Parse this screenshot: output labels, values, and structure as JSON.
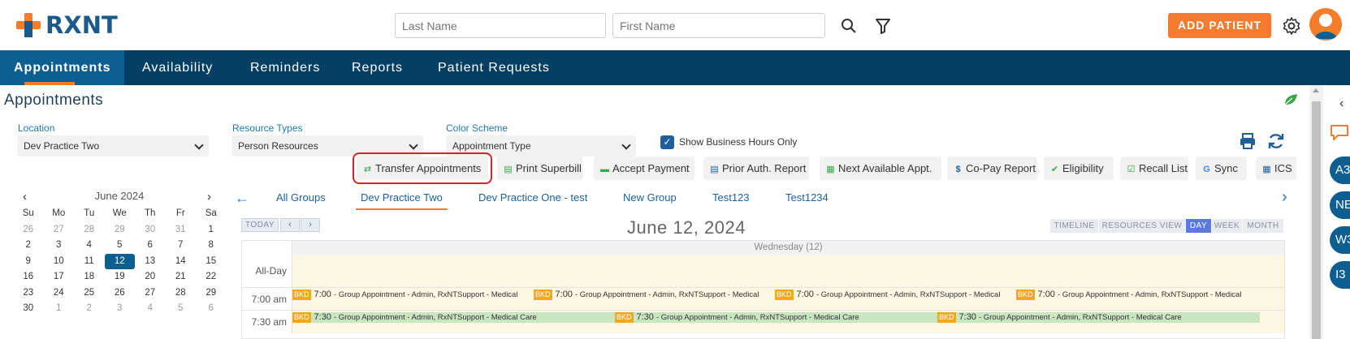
{
  "brand": {
    "name": "RXNT"
  },
  "header": {
    "last_name_placeholder": "Last Name",
    "first_name_placeholder": "First Name",
    "add_patient": "ADD PATIENT"
  },
  "nav": {
    "items": [
      "Appointments",
      "Availability",
      "Reminders",
      "Reports",
      "Patient Requests"
    ],
    "active": "Appointments"
  },
  "page": {
    "title": "Appointments"
  },
  "filters": {
    "location": {
      "label": "Location",
      "value": "Dev Practice Two"
    },
    "resource_types": {
      "label": "Resource Types",
      "value": "Person Resources"
    },
    "color_scheme": {
      "label": "Color Scheme",
      "value": "Appointment Type"
    },
    "business_hours": {
      "label": "Show Business Hours Only",
      "checked": true
    }
  },
  "actions": [
    "Transfer Appointments",
    "Print Superbill",
    "Accept Payment",
    "Prior Auth. Report",
    "Next Available Appt.",
    "Co-Pay Report",
    "Eligibility",
    "Recall List",
    "Sync",
    "ICS"
  ],
  "mini_calendar": {
    "month": "June 2024",
    "days_of_week": [
      "Su",
      "Mo",
      "Tu",
      "We",
      "Th",
      "Fr",
      "Sa"
    ],
    "weeks": [
      [
        "26",
        "27",
        "28",
        "29",
        "30",
        "31",
        "1"
      ],
      [
        "2",
        "3",
        "4",
        "5",
        "6",
        "7",
        "8"
      ],
      [
        "9",
        "10",
        "11",
        "12",
        "13",
        "14",
        "15"
      ],
      [
        "16",
        "17",
        "18",
        "19",
        "20",
        "21",
        "22"
      ],
      [
        "23",
        "24",
        "25",
        "26",
        "27",
        "28",
        "29"
      ],
      [
        "30",
        "1",
        "2",
        "3",
        "4",
        "5",
        "6"
      ]
    ],
    "selected": "12"
  },
  "groups": {
    "tabs": [
      "All Groups",
      "Dev Practice Two",
      "Dev Practice One - test",
      "New Group",
      "Test123",
      "Test1234"
    ],
    "active": "Dev Practice Two"
  },
  "schedule": {
    "today": "TODAY",
    "date": "June 12, 2024",
    "views": [
      "TIMELINE",
      "RESOURCES VIEW",
      "DAY",
      "WEEK",
      "MONTH"
    ],
    "active_view": "DAY",
    "column": "Wednesday (12)",
    "all_day_label": "All-Day",
    "rows": [
      {
        "time": "7:00 am",
        "appts": [
          {
            "badge": "BKD",
            "time": "7:00",
            "text": "- Group Appointment - Admin, RxNTSupport - Medical"
          },
          {
            "badge": "BKD",
            "time": "7:00",
            "text": "- Group Appointment - Admin, RxNTSupport - Medical"
          },
          {
            "badge": "BKD",
            "time": "7:00",
            "text": "- Group Appointment - Admin, RxNTSupport - Medical"
          },
          {
            "badge": "BKD",
            "time": "7:00",
            "text": "- Group Appointment - Admin, RxNTSupport - Medical"
          }
        ]
      },
      {
        "time": "7:30 am",
        "appts": [
          {
            "badge": "BKD",
            "time": "7:30",
            "text": "- Group Appointment - Admin, RxNTSupport - Medical Care"
          },
          {
            "badge": "BKD",
            "time": "7:30",
            "text": "- Group Appointment - Admin, RxNTSupport - Medical Care"
          },
          {
            "badge": "BKD",
            "time": "7:30",
            "text": "- Group Appointment - Admin, RxNTSupport - Medical Care"
          }
        ]
      }
    ]
  },
  "right_rail": {
    "avatars": [
      "A3",
      "NE",
      "W3",
      "I3"
    ]
  },
  "colors": {
    "navy": "#053f63",
    "nav_active": "#0d5e91",
    "orange": "#f47c2a",
    "highlight": "#d8222a",
    "slot_bg": "#fbf7e3",
    "appt_green": "#c8e6c0",
    "badge": "#f0a81c"
  }
}
